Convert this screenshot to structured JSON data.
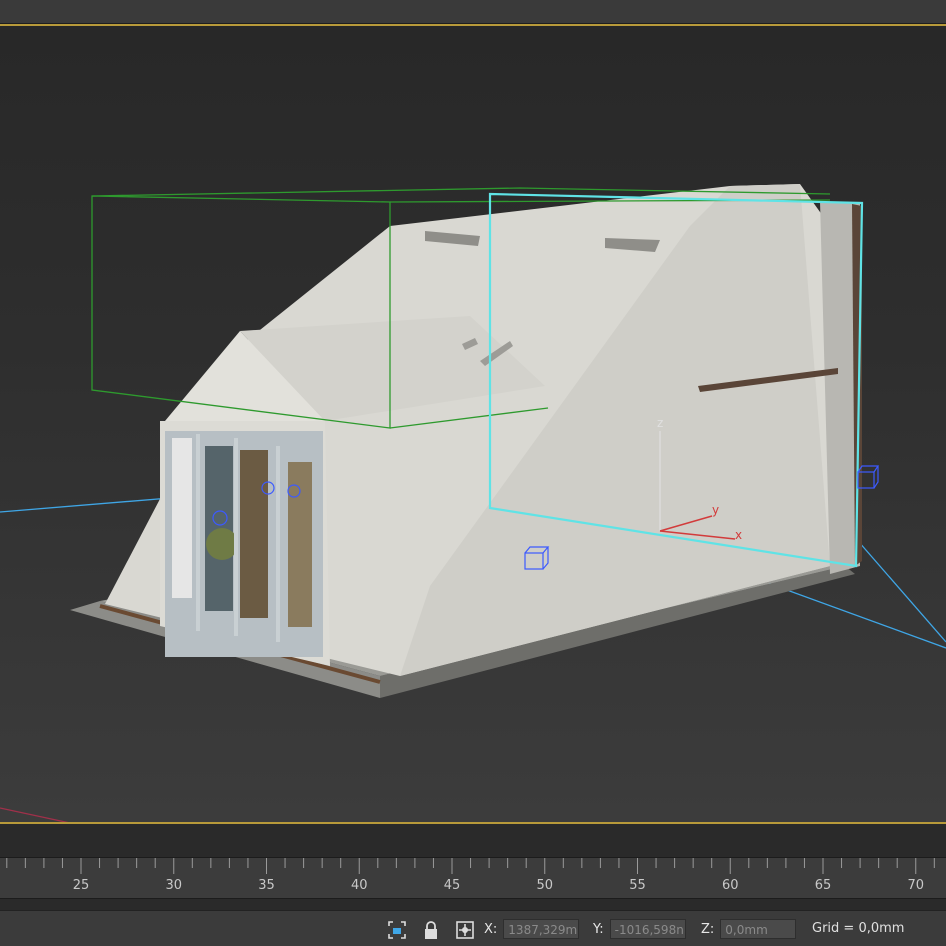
{
  "viewport": {
    "gizmo_labels": {
      "z": "z",
      "y": "y",
      "x": "x"
    }
  },
  "timeline": {
    "ticks": [
      "25",
      "30",
      "35",
      "40",
      "45",
      "50",
      "55",
      "60",
      "65",
      "70"
    ]
  },
  "statusbar": {
    "x_label": "X:",
    "x_value": "1387,329m",
    "y_label": "Y:",
    "y_value": "-1016,598n",
    "z_label": "Z:",
    "z_value": "0,0mm",
    "grid": "Grid = 0,0mm"
  },
  "icons": {
    "isolate": "isolate-selection-icon",
    "lock": "lock-icon",
    "transform_mode": "absolute-offset-mode-icon"
  },
  "colors": {
    "frame_accent": "#b89a3a",
    "selection_cyan": "#5fe3e6",
    "selection_green": "#2e9a2e",
    "axis_x": "#d23b3b",
    "axis_y": "#3fb0ff"
  }
}
